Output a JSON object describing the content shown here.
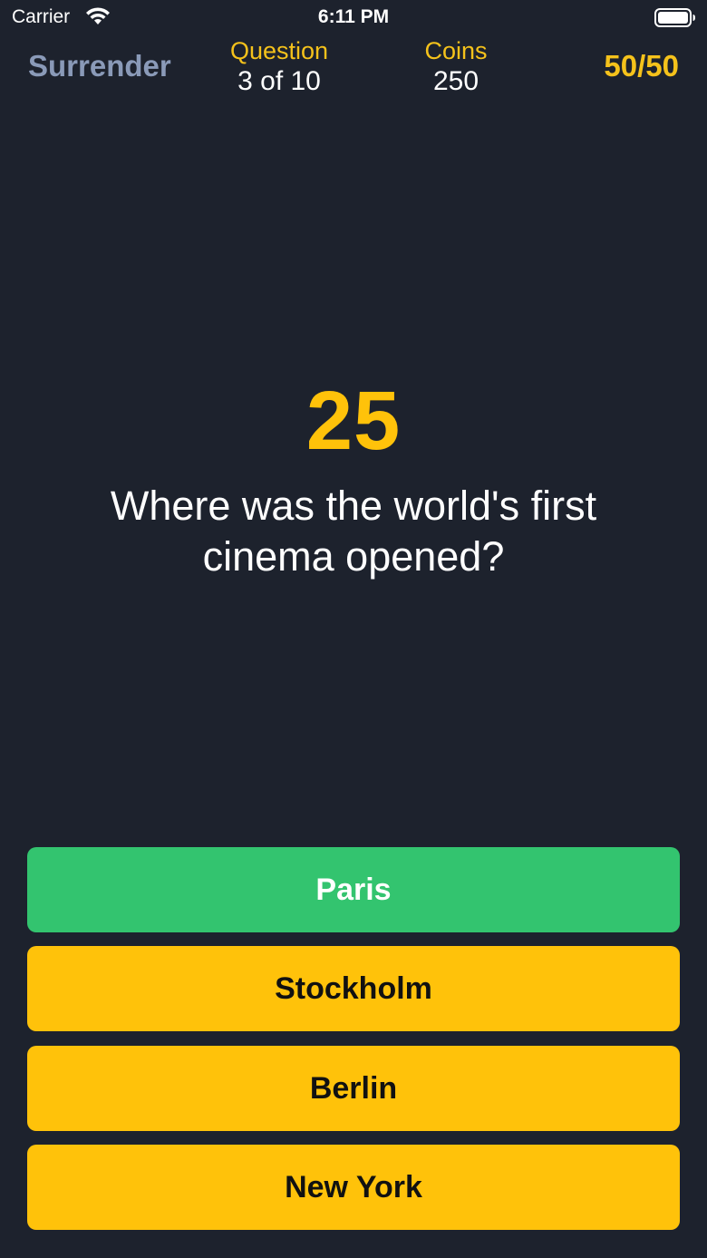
{
  "status_bar": {
    "carrier": "Carrier",
    "time": "6:11 PM",
    "icons": [
      "wifi-icon",
      "battery-icon"
    ]
  },
  "header": {
    "surrender_label": "Surrender",
    "question_label": "Question",
    "question_value": "3 of 10",
    "coins_label": "Coins",
    "coins_value": "250",
    "lifeline_label": "50/50"
  },
  "timer": "25",
  "question_text": "Where was the world's first cinema opened?",
  "answers": [
    {
      "label": "Paris",
      "state": "correct"
    },
    {
      "label": "Stockholm",
      "state": "normal"
    },
    {
      "label": "Berlin",
      "state": "normal"
    },
    {
      "label": "New York",
      "state": "normal"
    }
  ],
  "colors": {
    "background": "#1d222d",
    "accent_yellow": "#ffc20a",
    "correct_green": "#33c46f",
    "muted_blue": "#8a9ab8"
  }
}
